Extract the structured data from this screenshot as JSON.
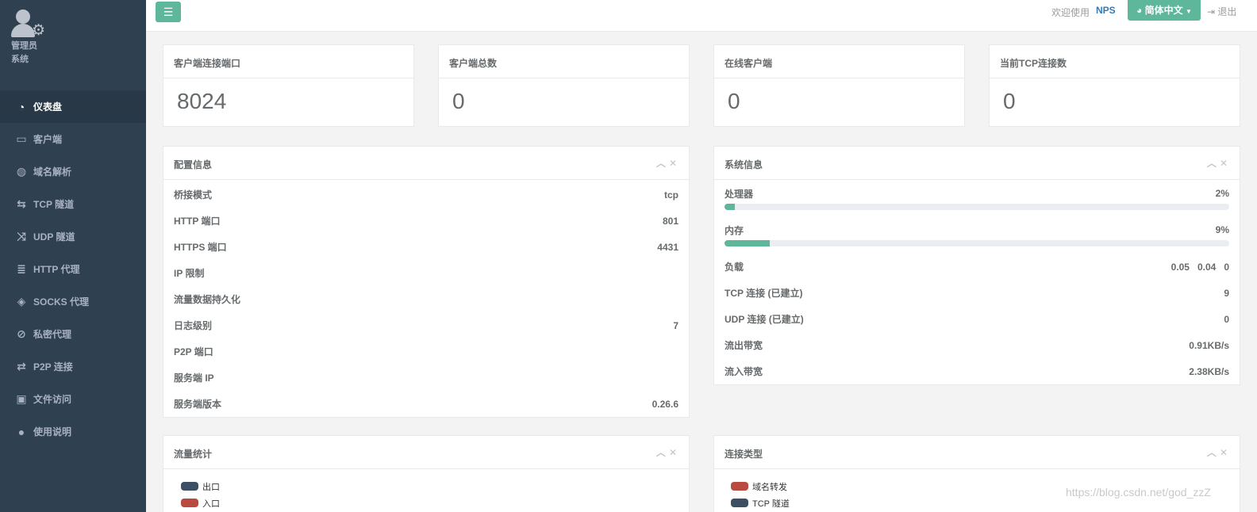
{
  "sidebar": {
    "profile": {
      "line1": "管理员",
      "line2": "系统"
    },
    "items": [
      {
        "label": "仪表盘",
        "icon": "dashboard-icon",
        "active": true
      },
      {
        "label": "客户端",
        "icon": "desktop-icon"
      },
      {
        "label": "域名解析",
        "icon": "globe-icon"
      },
      {
        "label": "TCP 隧道",
        "icon": "retweet-icon"
      },
      {
        "label": "UDP 隧道",
        "icon": "random-icon"
      },
      {
        "label": "HTTP 代理",
        "icon": "server-icon"
      },
      {
        "label": "SOCKS 代理",
        "icon": "layers-icon"
      },
      {
        "label": "私密代理",
        "icon": "eye-slash-icon"
      },
      {
        "label": "P2P 连接",
        "icon": "exchange-icon"
      },
      {
        "label": "文件访问",
        "icon": "briefcase-icon"
      },
      {
        "label": "使用说明",
        "icon": "lightbulb-icon"
      }
    ]
  },
  "topbar": {
    "menu_icon": "menu-icon",
    "welcome": "欢迎使用",
    "brand": "NPS",
    "language": "简体中文",
    "logout": "退出"
  },
  "stats": [
    {
      "title": "客户端连接端口",
      "value": "8024"
    },
    {
      "title": "客户端总数",
      "value": "0"
    },
    {
      "title": "在线客户端",
      "value": "0"
    },
    {
      "title": "当前TCP连接数",
      "value": "0"
    }
  ],
  "config": {
    "title": "配置信息",
    "rows": [
      {
        "label": "桥接模式",
        "value": "tcp"
      },
      {
        "label": "HTTP 端口",
        "value": "801"
      },
      {
        "label": "HTTPS 端口",
        "value": "4431"
      },
      {
        "label": "IP 限制",
        "value": ""
      },
      {
        "label": "流量数据持久化",
        "value": ""
      },
      {
        "label": "日志级别",
        "value": "7"
      },
      {
        "label": "P2P 端口",
        "value": ""
      },
      {
        "label": "服务端 IP",
        "value": ""
      },
      {
        "label": "服务端版本",
        "value": "0.26.6"
      }
    ]
  },
  "system": {
    "title": "系统信息",
    "cpu": {
      "label": "处理器",
      "value": "2%",
      "fraction": 0.02
    },
    "mem": {
      "label": "内存",
      "value": "9%",
      "fraction": 0.09
    },
    "rows": [
      {
        "label": "负载",
        "value": "0.05   0.04   0"
      },
      {
        "label": "TCP 连接 (已建立)",
        "value": "9"
      },
      {
        "label": "UDP 连接 (已建立)",
        "value": "0"
      },
      {
        "label": "流出带宽",
        "value": "0.91KB/s"
      },
      {
        "label": "流入带宽",
        "value": "2.38KB/s"
      }
    ]
  },
  "traffic": {
    "title": "流量统计",
    "legend": [
      {
        "label": "出口",
        "color": "#3d4f62"
      },
      {
        "label": "入口",
        "color": "#b94a3f"
      }
    ]
  },
  "conn_types": {
    "title": "连接类型",
    "legend": [
      {
        "label": "域名转发",
        "color": "#b94a3f"
      },
      {
        "label": "TCP 隧道",
        "color": "#3d4f62"
      }
    ]
  },
  "watermark": "https://blog.csdn.net/god_zzZ"
}
